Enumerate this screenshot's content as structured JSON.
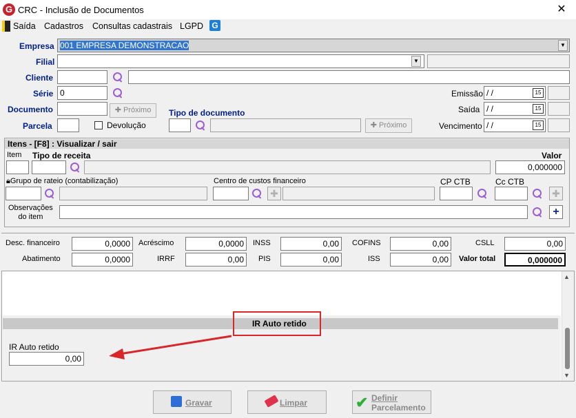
{
  "window": {
    "title": "CRC - Inclusão de Documentos",
    "close": "✕"
  },
  "menu": {
    "items": [
      "Saída",
      "Cadastros",
      "Consultas cadastrais",
      "LGPD"
    ]
  },
  "header": {
    "empresa_label": "Empresa",
    "empresa_value": "001 EMPRESA DEMONSTRACAO",
    "filial_label": "Filial",
    "cliente_label": "Cliente",
    "serie_label": "Série",
    "serie_value": "0",
    "documento_label": "Documento",
    "proximo": "Próximo",
    "parcela_label": "Parcela",
    "devolucao_label": "Devolução",
    "tipo_documento_label": "Tipo de documento",
    "proximo2": "Próximo",
    "emissao_label": "Emissão",
    "emissao_value": " / /",
    "saida_label": "Saída",
    "saida_value": " / /",
    "vencimento_label": "Vencimento",
    "vencimento_value": " / /",
    "cal": "15"
  },
  "itens": {
    "header": "Itens  - [F8] : Visualizar / sair",
    "item_label": "Item",
    "tipo_receita_label": "Tipo de receita",
    "valor_label": "Valor",
    "valor_value": "0,000000",
    "grupo_rateio_label": "Grupo de rateio (contabilização)",
    "centro_custos_label": "Centro de custos financeiro",
    "cp_ctb_label": "CP CTB",
    "cc_ctb_label": "Cc CTB",
    "obs_label_1": "Observações",
    "obs_label_2": "do item"
  },
  "totais": {
    "desc_financeiro_label": "Desc. financeiro",
    "desc_financeiro": "0,0000",
    "acrescimo_label": "Acréscimo",
    "acrescimo": "0,0000",
    "inss_label": "INSS",
    "inss": "0,00",
    "cofins_label": "COFINS",
    "cofins": "0,00",
    "csll_label": "CSLL",
    "csll": "0,00",
    "abatimento_label": "Abatimento",
    "abatimento": "0,0000",
    "irrf_label": "IRRF",
    "irrf": "0,00",
    "pis_label": "PIS",
    "pis": "0,00",
    "iss_label": "ISS",
    "iss": "0,00",
    "valor_total_label": "Valor total",
    "valor_total": "0,000000"
  },
  "ir": {
    "header": "IR Auto retido",
    "field_label": "IR Auto retido",
    "field_value": "0,00"
  },
  "buttons": {
    "gravar": "Gravar",
    "limpar": "Limpar",
    "definir_1": "Definir",
    "definir_2": "Parcelamento"
  },
  "colors": {
    "label_blue": "#001e8c",
    "highlight": "#3175cf",
    "annotation_red": "#d9262b",
    "lupa": "#9b5fd1"
  }
}
